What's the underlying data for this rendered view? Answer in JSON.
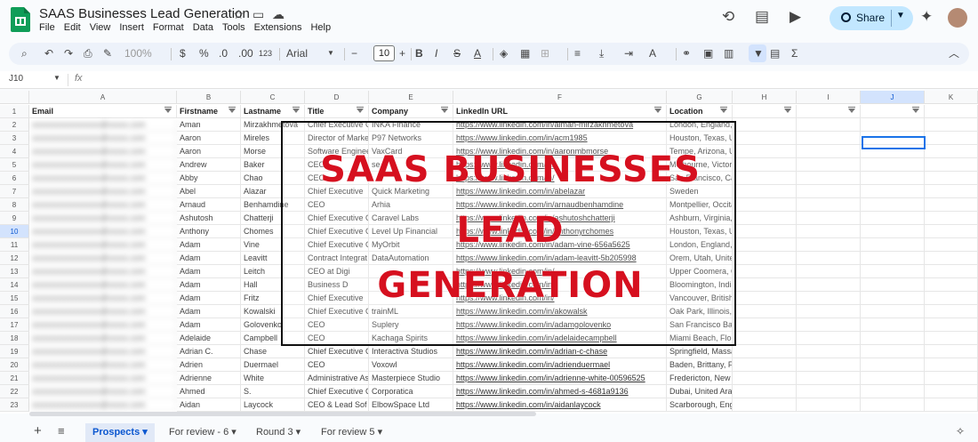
{
  "app": {
    "title": "SAAS Businesses Lead Generation",
    "menus": [
      "File",
      "Edit",
      "View",
      "Insert",
      "Format",
      "Data",
      "Tools",
      "Extensions",
      "Help"
    ],
    "share_label": "Share"
  },
  "toolbar": {
    "zoom": "100%",
    "currency": "$",
    "percent": "%",
    "dec_decrease": ".0",
    "dec_increase": ".00",
    "number_format": "123",
    "font": "Arial",
    "font_size": "10"
  },
  "formula": {
    "name_box": "J10",
    "fx": "fx"
  },
  "columns": [
    "A",
    "B",
    "C",
    "D",
    "E",
    "F",
    "G",
    "H",
    "I",
    "J",
    "K"
  ],
  "headers": [
    "Email",
    "Firstname",
    "Lastname",
    "Title",
    "Company",
    "LinkedIn URL",
    "Location",
    "",
    "",
    "",
    ""
  ],
  "row_numbers": [
    "1",
    "2",
    "3",
    "4",
    "5",
    "6",
    "7",
    "8",
    "9",
    "10",
    "11",
    "12",
    "13",
    "14",
    "15",
    "16",
    "17",
    "18",
    "19",
    "20",
    "21",
    "22",
    "23"
  ],
  "rows": [
    {
      "first": "Aman",
      "last": "Mirzakhmetova",
      "title": "Chief Executive O",
      "company": "INKA Finance",
      "url": "https://www.linkedin.com/in/aiman-mirzakhmetova",
      "loc": "London, England, United Kingdom"
    },
    {
      "first": "Aaron",
      "last": "Mireles",
      "title": "Director of Marke",
      "company": "P97 Networks",
      "url": "https://www.linkedin.com/in/acm1985",
      "loc": "Houston, Texas, United States"
    },
    {
      "first": "Aaron",
      "last": "Morse",
      "title": "Software Enginee",
      "company": "VaxCard",
      "url": "https://www.linkedin.com/in/aaronmbmorse",
      "loc": "Tempe, Arizona, United States"
    },
    {
      "first": "Andrew",
      "last": "Baker",
      "title": "CEO",
      "company": "se",
      "url": "https://www.linkedin.com/in/",
      "loc": "Melbourne, Victoria, Australia"
    },
    {
      "first": "Abby",
      "last": "Chao",
      "title": "CEO",
      "company": "",
      "url": "https://www.linkedin.com/in/",
      "loc": "San Francisco, California, United States"
    },
    {
      "first": "Abel",
      "last": "Alazar",
      "title": "Chief Executive",
      "company": "Quick Marketing",
      "url": "https://www.linkedin.com/in/abelazar",
      "loc": "Sweden"
    },
    {
      "first": "Arnaud",
      "last": "Benhamdine",
      "title": "CEO",
      "company": "Arhia",
      "url": "https://www.linkedin.com/in/arnaudbenhamdine",
      "loc": "Montpellier, Occitanie, France"
    },
    {
      "first": "Ashutosh",
      "last": "Chatterji",
      "title": "Chief Executive O",
      "company": "Caravel Labs",
      "url": "https://www.linkedin.com/in/ashutoshchatterji",
      "loc": "Ashburn, Virginia, United States"
    },
    {
      "first": "Anthony",
      "last": "Chomes",
      "title": "Chief Executive O",
      "company": "Level Up Financial",
      "url": "https://www.linkedin.com/in/anthonyrchomes",
      "loc": "Houston, Texas, United States"
    },
    {
      "first": "Adam",
      "last": "Vine",
      "title": "Chief Executive O",
      "company": "MyOrbit",
      "url": "https://www.linkedin.com/in/adam-vine-656a5625",
      "loc": "London, England, United Kingdom"
    },
    {
      "first": "Adam",
      "last": "Leavitt",
      "title": "Contract Integrat",
      "company": "DataAutomation",
      "url": "https://www.linkedin.com/in/adam-leavitt-5b205998",
      "loc": "Orem, Utah, United States"
    },
    {
      "first": "Adam",
      "last": "Leitch",
      "title": "CEO at Digi",
      "company": "",
      "url": "https://www.linkedin.com/in/",
      "loc": "Upper Coomera, Queensland, Australia"
    },
    {
      "first": "Adam",
      "last": "Hall",
      "title": "Business D",
      "company": "",
      "url": "https://www.linkedin.com/in/",
      "loc": "Bloomington, Indiana, United States"
    },
    {
      "first": "Adam",
      "last": "Fritz",
      "title": "Chief Executive",
      "company": "",
      "url": "https://www.linkedin.com/in/",
      "loc": "Vancouver, British Columbia, Canada"
    },
    {
      "first": "Adam",
      "last": "Kowalski",
      "title": "Chief Executive O",
      "company": "trainML",
      "url": "https://www.linkedin.com/in/akowalsk",
      "loc": "Oak Park, Illinois, United States"
    },
    {
      "first": "Adam",
      "last": "Golovenko",
      "title": "CEO",
      "company": "Suplery",
      "url": "https://www.linkedin.com/in/adamgolovenko",
      "loc": "San Francisco Bay Area"
    },
    {
      "first": "Adelaide",
      "last": "Campbell",
      "title": "CEO",
      "company": "Kachaga Spirits",
      "url": "https://www.linkedin.com/in/adelaidecampbell",
      "loc": "Miami Beach, Florida, United States"
    },
    {
      "first": "Adrian C.",
      "last": "Chase",
      "title": "Chief Executive O",
      "company": "Interactiva Studios",
      "url": "https://www.linkedin.com/in/adrian-c-chase",
      "loc": "Springfield, Massachusetts Metropolitan Area"
    },
    {
      "first": "Adrien",
      "last": "Duermael",
      "title": "CEO",
      "company": "Voxowl",
      "url": "https://www.linkedin.com/in/adrienduermael",
      "loc": "Baden, Brittany, France"
    },
    {
      "first": "Adrienne",
      "last": "White",
      "title": "Administrative As",
      "company": "Masterpiece Studio",
      "url": "https://www.linkedin.com/in/adrienne-white-00596525",
      "loc": "Fredericton, New Brunswick, Canada"
    },
    {
      "first": "Ahmed",
      "last": "S.",
      "title": "Chief Executive O",
      "company": "Corporatica",
      "url": "https://www.linkedin.com/in/ahmed-s-4681a9136",
      "loc": "Dubai, United Arab Emirates"
    },
    {
      "first": "Aidan",
      "last": "Laycock",
      "title": "CEO & Lead Sof",
      "company": "ElbowSpace Ltd",
      "url": "https://www.linkedin.com/in/aidanlaycock",
      "loc": "Scarborough, England, United Kingdom"
    }
  ],
  "overlay": {
    "line1": "SAAS BUSINESSES",
    "line2": "LEAD",
    "line3": "GENERATION",
    "color": "#d6101f"
  },
  "sheets": [
    {
      "label": "Prospects",
      "active": true
    },
    {
      "label": "For review - 6",
      "active": false
    },
    {
      "label": "Round 3",
      "active": false
    },
    {
      "label": "For review 5",
      "active": false
    }
  ]
}
